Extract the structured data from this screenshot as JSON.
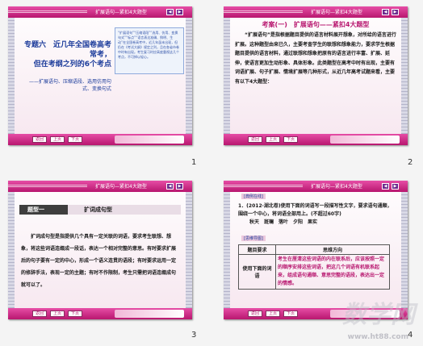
{
  "header_text": "扩展语句—紧扣4大题型",
  "nav": {
    "back": "◀",
    "forward": "▶"
  },
  "footer_controls": [
    "返回",
    "上页",
    "下页"
  ],
  "slide1": {
    "title_line1": "专题六　近几年全国卷高考常考，",
    "title_line2": "但在考纲之列的6个考点",
    "subtitle": "——扩展语句、压缩语段、选用仿用句式、变换句式",
    "box_text": "“扩展语句”“压缩语段”“选用、仿用、变换句式”“标点”“语言表达准确、鲜明、生动”在全国卷高考中，近几年虽未出现，但仍在《考试大纲》规定之列，且在各省市卷中时有出现。考生复习时应高度重视这几个考点，不可掉以轻心。"
  },
  "slide2": {
    "title": "考案(一)　扩展语句——紧扣4大题型",
    "text": "“扩展语句”是指根据题目提供的语言材料展开想象，对所给的语言进行扩展。这种题型由来已久，主要考查学生的联想和想象能力，要求学生根据题目提供的语言材料，通过联想和想象把原有的语言进行丰富、扩展、延伸，使语言更加生动形象、具体形象。此类题型在高考中时有出现，主要有词语扩展、句子扩展、情境扩展等几种形式，从近几年高考试题来看，主要有以下4大题型："
  },
  "slide3": {
    "tag": "题型一",
    "heading": "扩词成句型",
    "text": "扩词成句型是指提供几个具有一定关联的词语，要求考生联想、想象，将这些词语连缀成一段话，表达一个相对完整的意思。有时要求扩展后的句子要有一定的中心，形成一个语义连贯的语段；有时要求运用一定的修辞手法，表现一定的主题；有时不作限制，考生只需把词语连缀成句就可以了。"
  },
  "slide4": {
    "label_example": "[典例在线]",
    "question": "1．(2012·湖北卷)使用下面的词语写一段描写性文字，要求语句通顺，围绕一个中心，将词语全部用上。(不超过60字)",
    "words": "秋天　斑斓　落叶　夕阳　果实",
    "label_analysis": "[思维导图]",
    "table": {
      "headers": [
        "题目要求",
        "思维方向"
      ],
      "row_key": "使用下面的词语",
      "row_value": "考生在厘清这些词语的内在联系后，应该按照一定的顺序安排这些词语，把这几个词语有机联系起来，组成语句通顺、意思完整的语段，表达出一定的情感。"
    }
  },
  "page_numbers": [
    "1",
    "2",
    "3",
    "4"
  ],
  "watermark": "数学网",
  "watermark_url": "www.ht88.com"
}
